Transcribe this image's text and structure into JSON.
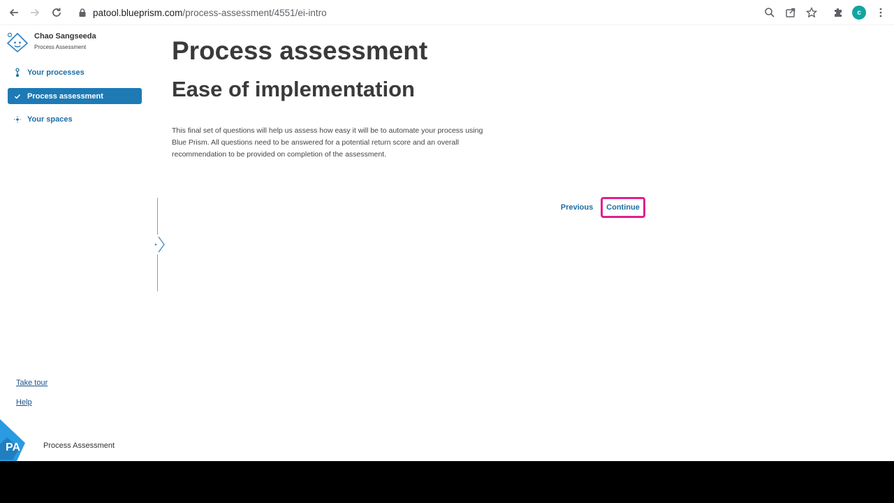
{
  "browser": {
    "url_host": "patool.blueprism.com",
    "url_path": "/process-assessment/4551/ei-intro",
    "profile_initial": "c"
  },
  "user": {
    "name": "Chao Sangseeda",
    "role": "Process Assessment"
  },
  "sidebar": {
    "items": [
      {
        "label": "Your processes",
        "icon": "process-icon"
      },
      {
        "label": "Process assessment",
        "icon": "check-icon",
        "active": true
      },
      {
        "label": "Your spaces",
        "icon": "sparkle-icon"
      }
    ],
    "take_tour": "Take tour",
    "help": "Help",
    "brand_text": "Process Assessment",
    "brand_logo_text": "PA"
  },
  "main": {
    "title": "Process assessment",
    "subtitle": "Ease of implementation",
    "description": "This final set of questions will help us assess how easy it will be to automate your process using Blue Prism. All questions need to be answered for a potential return score and an overall recommendation to be provided on completion of the assessment.",
    "previous_label": "Previous",
    "continue_label": "Continue"
  },
  "colors": {
    "accent": "#1d7ab5",
    "highlight": "#e0208f",
    "brand": "#2a9be0"
  }
}
